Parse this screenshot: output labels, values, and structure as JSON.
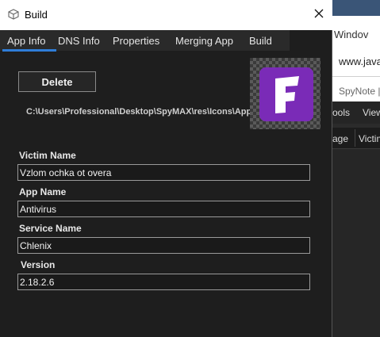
{
  "window": {
    "title": "Build",
    "app_icon": "cube-icon",
    "close_icon": "close-icon"
  },
  "tabs": [
    {
      "label": "App Info",
      "active": true
    },
    {
      "label": "DNS Info",
      "active": false
    },
    {
      "label": "Properties",
      "active": false
    },
    {
      "label": "Merging App",
      "active": false
    },
    {
      "label": "Build",
      "active": false
    }
  ],
  "app_info": {
    "delete_label": "Delete",
    "icon_path": "C:\\Users\\Professional\\Desktop\\SpyMAX\\res\\Icons\\App",
    "app_icon_name": "fortnite-f-icon",
    "fields": {
      "victim_name": {
        "label": "Victim Name",
        "value": "Vzlom ochka ot overa"
      },
      "app_name": {
        "label": "App Name",
        "value": "Antivirus"
      },
      "service_name": {
        "label": "Service Name",
        "value": "Chlenix"
      },
      "version": {
        "label": "Version",
        "value": "2.18.2.6"
      }
    }
  },
  "background_window": {
    "title_fragment": "Windov",
    "url_fragment": "www.java",
    "tab_fragment": "SpyNote |",
    "menu_items": [
      "ools",
      "View"
    ],
    "columns": [
      "age",
      "Victim"
    ]
  },
  "colors": {
    "accent": "#2f7dd8",
    "icon_bg": "#7a2bb7"
  }
}
